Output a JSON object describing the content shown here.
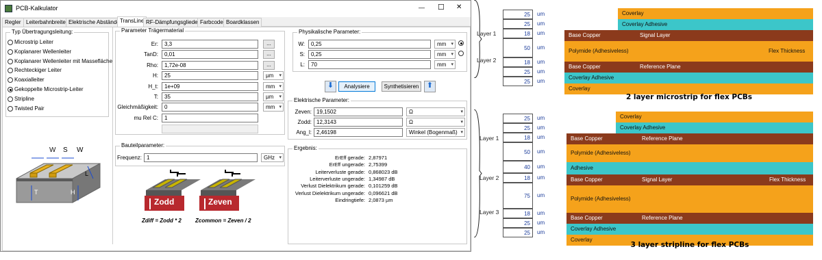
{
  "window": {
    "title": "PCB-Kalkulator",
    "controls": {
      "minimize": "—",
      "maximize": "☐",
      "close": "✕"
    }
  },
  "tabs": [
    "Regler",
    "Leiterbahnbreite",
    "Elektrische Abstände",
    "TransLine",
    "RF-Dämpfungsglieder",
    "Farbcode",
    "Boardklassen"
  ],
  "active_tab": "TransLine",
  "line_type": {
    "title": "Typ Übertragungsleitung:",
    "options": [
      "Microstrip Leiter",
      "Koplanarer Wellenleiter",
      "Koplanarer Wellenleiter mit Massefläche",
      "Rechteckiger Leiter",
      "Koaxialleiter",
      "Gekoppelte Microstrip-Leiter",
      "Stripline",
      "Twisted Pair"
    ],
    "selected": 5
  },
  "diagram_labels": {
    "w": "W",
    "s": "S",
    "w2": "W",
    "t": "T",
    "h": "H",
    "l": "L"
  },
  "substrate": {
    "title": "Parameter Trägermaterial",
    "fields": [
      {
        "label": "Er:",
        "value": "3,3"
      },
      {
        "label": "TanD:",
        "value": "0,01"
      },
      {
        "label": "Rho:",
        "value": "1,72e-08"
      },
      {
        "label": "H:",
        "value": "25",
        "unit": "µm"
      },
      {
        "label": "H_t:",
        "value": "1e+09",
        "unit": "mm"
      },
      {
        "label": "T:",
        "value": "35",
        "unit": "µm"
      },
      {
        "label": "Gleichmäßigkeit:",
        "value": "0",
        "unit": "mm"
      },
      {
        "label": "mu Rel C:",
        "value": "1"
      }
    ],
    "dots_label": "..."
  },
  "component": {
    "title": "Bauteilparameter:",
    "label": "Frequenz:",
    "value": "1",
    "unit": "GHz"
  },
  "physical": {
    "title": "Physikalische Parameter:",
    "fields": [
      {
        "label": "W:",
        "value": "0,25",
        "unit": "mm"
      },
      {
        "label": "S:",
        "value": "0,25",
        "unit": "mm"
      },
      {
        "label": "L:",
        "value": "70",
        "unit": "mm"
      }
    ]
  },
  "buttons": {
    "analyze": "Analysiere",
    "synthesize": "Synthetisieren"
  },
  "electrical": {
    "title": "Elektrische Parameter:",
    "fields": [
      {
        "label": "Zeven:",
        "value": "19,1502",
        "unit": "Ω"
      },
      {
        "label": "Zodd:",
        "value": "12,3143",
        "unit": "Ω"
      },
      {
        "label": "Ang_l:",
        "value": "2,46198",
        "unit": "Winkel (Bogenmaß)"
      }
    ]
  },
  "results": {
    "title": "Ergebnis:",
    "rows": [
      {
        "label": "ErEff gerade:",
        "value": "2,87971"
      },
      {
        "label": "ErEff ungerade:",
        "value": "2,75399"
      },
      {
        "label": "Leiterverluste gerade:",
        "value": "0,868023 dB"
      },
      {
        "label": "Leiterverluste ungerade:",
        "value": "1,34987 dB"
      },
      {
        "label": "Verlust Dielektrikum gerade:",
        "value": "0,101259 dB"
      },
      {
        "label": "Verlust Dielektrikum ungerade:",
        "value": "0,096621 dB"
      },
      {
        "label": "Eindringtiefe:",
        "value": "2,0873 µm"
      }
    ]
  },
  "formula": {
    "zodd": "Zodd",
    "zeven": "Zeven",
    "diff": "Zdiff = Zodd * 2",
    "common": "Zcommon = Zeven / 2"
  },
  "stackup1": {
    "thicknesses": [
      "25",
      "25",
      "18",
      "50",
      "18",
      "25",
      "25"
    ],
    "unit": "um",
    "layer_labels": [
      "Layer 1",
      "Layer 2"
    ],
    "bands": [
      {
        "text": "Coverlay",
        "color": "#f5a21b"
      },
      {
        "text": "Coverlay Adhesive",
        "color": "#3cc6c9"
      },
      {
        "text": "Base Copper",
        "text2": "Signal Layer",
        "color": "#8b3a1c"
      },
      {
        "text": "Polymide (Adhesiveless)",
        "text2": "Flex Thickness",
        "color": "#f5a21b"
      },
      {
        "text": "Base Copper",
        "text2": "Reference Plane",
        "color": "#8b3a1c"
      },
      {
        "text": "Coverlay Adhesive",
        "color": "#3cc6c9"
      },
      {
        "text": "Coverlay",
        "color": "#f5a21b"
      }
    ],
    "caption": "2 layer microstrip for flex PCBs"
  },
  "stackup2": {
    "thicknesses": [
      "25",
      "25",
      "18",
      "50",
      "40",
      "18",
      "75",
      "18",
      "25",
      "25"
    ],
    "unit": "um",
    "layer_labels": [
      "Layer 1",
      "Layer 2",
      "Layer 3"
    ],
    "bands": [
      {
        "text": "Coverlay",
        "color": "#f5a21b"
      },
      {
        "text": "Coverlay Adhesive",
        "color": "#3cc6c9"
      },
      {
        "text": "Base Copper",
        "text2": "Reference Plane",
        "color": "#8b3a1c"
      },
      {
        "text": "Polymide (Adhesiveless)",
        "color": "#f5a21b"
      },
      {
        "text": "Adhesive",
        "color": "#3cc6c9"
      },
      {
        "text": "Base Copper",
        "text2": "Signal Layer",
        "text3": "Flex Thickness",
        "color": "#8b3a1c"
      },
      {
        "text": "Polymide (Adhesiveless)",
        "color": "#f5a21b"
      },
      {
        "text": "Base Copper",
        "text2": "Reference Plane",
        "color": "#8b3a1c"
      },
      {
        "text": "Coverlay Adhesive",
        "color": "#3cc6c9"
      },
      {
        "text": "Coverlay",
        "color": "#f5a21b"
      }
    ],
    "caption": "3 layer stripline for flex PCBs"
  }
}
